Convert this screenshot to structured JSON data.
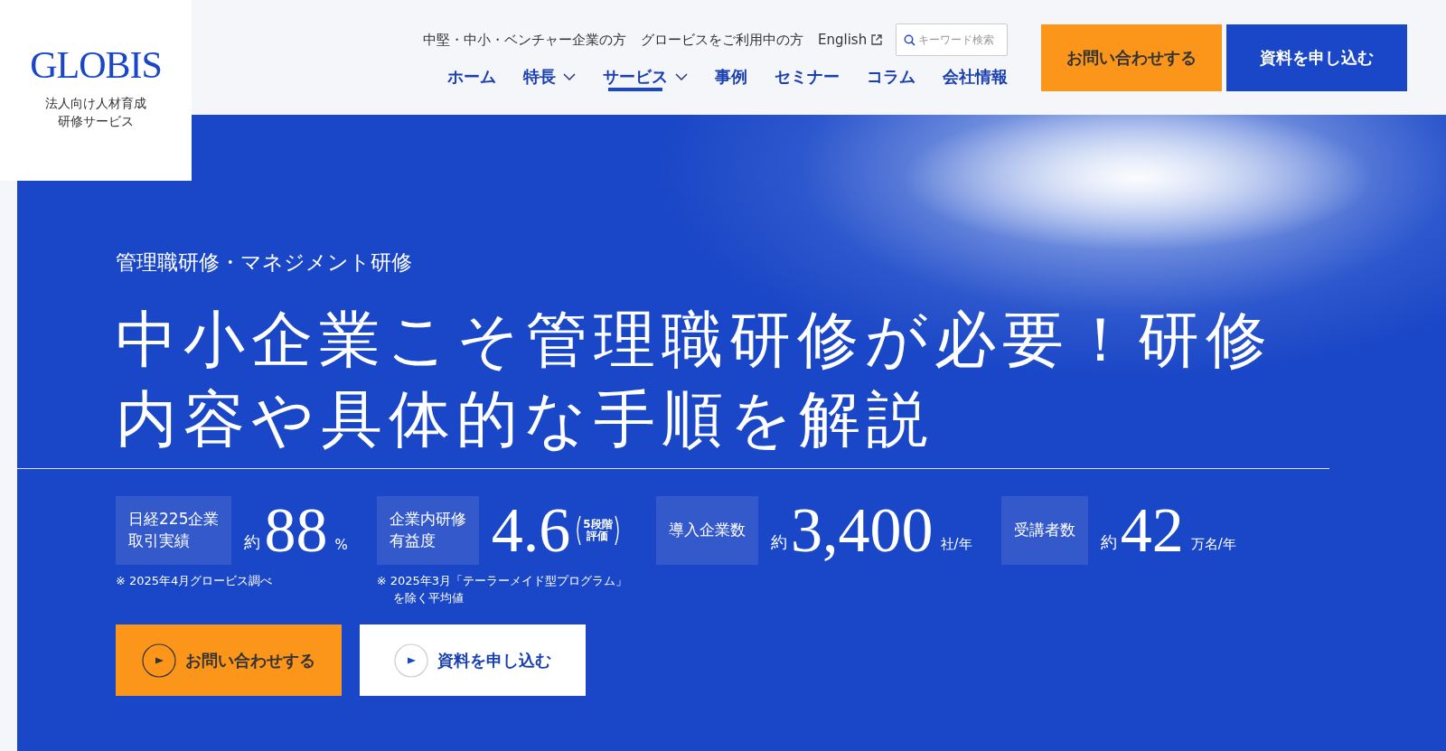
{
  "logo": {
    "wordmark": "GLOBIS",
    "tagline": [
      "法人向け人材育成",
      "研修サービス"
    ]
  },
  "utility_links": [
    {
      "label": "中堅・中小・ベンチャー企業の方",
      "external": false
    },
    {
      "label": "グロービスをご利用中の方",
      "external": false
    },
    {
      "label": "English",
      "external": true
    }
  ],
  "search": {
    "placeholder": "キーワード検索"
  },
  "nav": [
    {
      "label": "ホーム",
      "dropdown": false,
      "selected": false
    },
    {
      "label": "特長",
      "dropdown": true,
      "selected": false
    },
    {
      "label": "サービス",
      "dropdown": true,
      "selected": true
    },
    {
      "label": "事例",
      "dropdown": false,
      "selected": false
    },
    {
      "label": "セミナー",
      "dropdown": false,
      "selected": false
    },
    {
      "label": "コラム",
      "dropdown": false,
      "selected": false
    },
    {
      "label": "会社情報",
      "dropdown": false,
      "selected": false
    }
  ],
  "header_buttons": [
    {
      "label": "お問い合わせする",
      "kind": "primary"
    },
    {
      "label": "資料を申し込む",
      "kind": "secondary"
    }
  ],
  "hero": {
    "category": "管理職研修・マネジメント研修",
    "title": "中小企業こそ管理職研修が必要！研修内容や具体的な手順を解説",
    "stats": [
      {
        "label": [
          "日経225企業",
          "取引実績"
        ],
        "prefix": "約",
        "value": "88",
        "unit": "%",
        "note": [
          "※ 2025年4月グロービス調べ"
        ]
      },
      {
        "label": [
          "企業内研修",
          "有益度"
        ],
        "value": "4.6",
        "unit_bracketed": [
          "5段階",
          "評価"
        ],
        "note": [
          "※ 2025年3月「テーラーメイド型プログラム」",
          "を除く平均値"
        ]
      },
      {
        "label": [
          "導入企業数"
        ],
        "prefix": "約",
        "value": "3,400",
        "unit": "社/年"
      },
      {
        "label": [
          "受講者数"
        ],
        "prefix": "約",
        "value": "42",
        "unit": "万名/年"
      }
    ],
    "buttons": [
      {
        "label": "お問い合わせする",
        "kind": "primary"
      },
      {
        "label": "資料を申し込む",
        "kind": "secondary"
      }
    ]
  }
}
